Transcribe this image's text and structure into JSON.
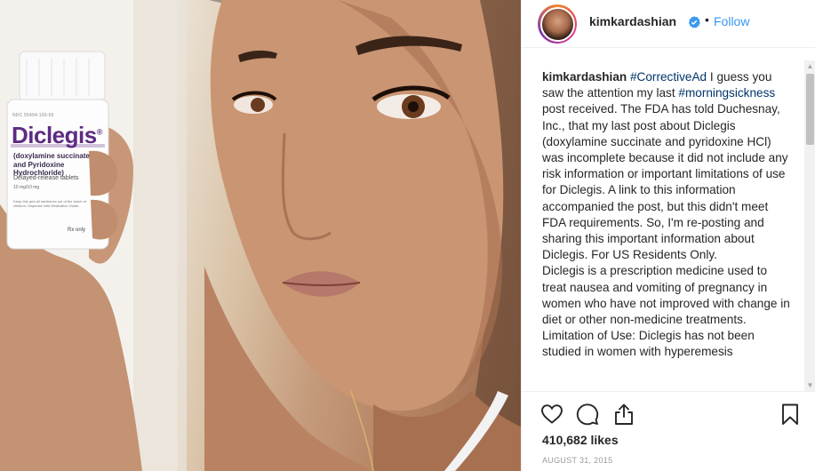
{
  "photo": {
    "bottle": {
      "ndc": "NDC 55494-100-65",
      "brand": "Diclegis",
      "reg_mark": "®",
      "generic": "(doxylamine succinate and Pyridoxine Hydrochloride)",
      "tablets": "Delayed-release tablets",
      "dose": "10 mg/10 mg",
      "fine_print": "Keep this and all medicines out of the reach of children. Dispense with Medication Guide.",
      "rx": "Rx only"
    }
  },
  "post": {
    "username": "kimkardashian",
    "follow_label": "Follow",
    "caption": {
      "username": "kimkardashian",
      "hashtag_1": "#CorrectiveAd",
      "text_1": " I guess you saw the attention my last ",
      "hashtag_2": "#morningsickness",
      "text_2": " post received. The FDA has told Duchesnay, Inc., that my last post about Diclegis (doxylamine succinate and pyridoxine HCl) was incomplete because it did not include any risk information or important limitations of use for Diclegis. A link to this information accompanied the post, but this didn't meet FDA requirements. So, I'm re-posting and sharing this important information about Diclegis. For US Residents Only.",
      "para_2": "Diclegis is a prescription medicine used to treat nausea and vomiting of pregnancy in women who have not improved with change in diet or other non-medicine treatments.",
      "para_3": "Limitation of Use: Diclegis has not been studied in women with hyperemesis"
    },
    "likes": "410,682 likes",
    "date": "AUGUST 31, 2015",
    "colors": {
      "link": "#3897f0",
      "hashtag": "#003569",
      "verified": "#3897f0"
    }
  }
}
